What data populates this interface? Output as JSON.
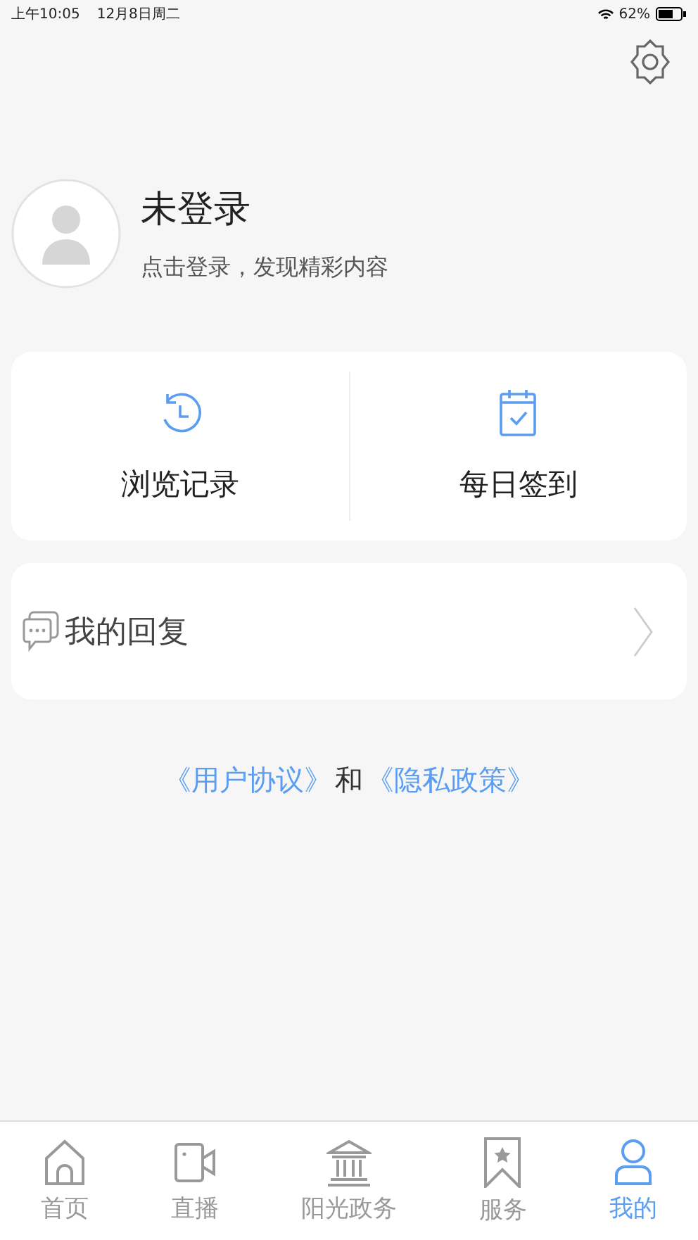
{
  "status_bar": {
    "time": "上午10:05",
    "date": "12月8日周二",
    "battery": "62%"
  },
  "profile": {
    "name": "未登录",
    "hint": "点击登录，发现精彩内容"
  },
  "shortcuts": [
    {
      "kind": "history",
      "label": "浏览记录"
    },
    {
      "kind": "calendar",
      "label": "每日签到"
    }
  ],
  "menu": [
    {
      "kind": "chat",
      "label": "我的回复"
    }
  ],
  "agreement": [
    {
      "kind": "link",
      "text": "《用户协议》"
    },
    {
      "kind": "text",
      "text": "和"
    },
    {
      "kind": "link",
      "text": "《隐私政策》"
    }
  ],
  "tabs": [
    {
      "kind": "home",
      "label": "首页",
      "selected": false
    },
    {
      "kind": "video",
      "label": "直播",
      "selected": false
    },
    {
      "kind": "bank",
      "label": "阳光政务",
      "selected": false
    },
    {
      "kind": "bookmark",
      "label": "服务",
      "selected": false
    },
    {
      "kind": "person",
      "label": "我的",
      "selected": true
    }
  ]
}
